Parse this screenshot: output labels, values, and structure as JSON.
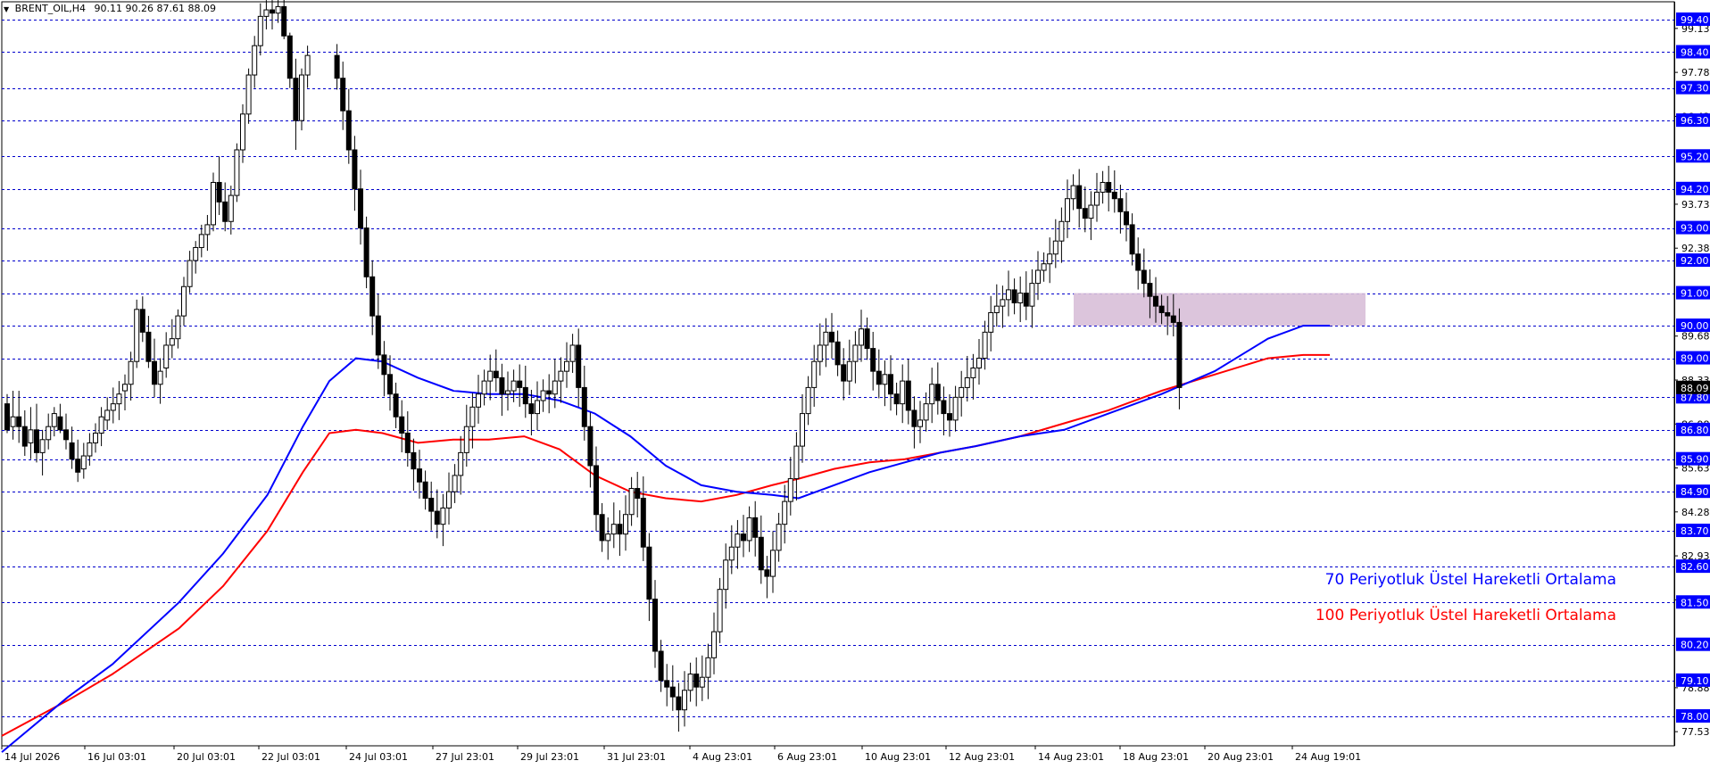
{
  "header": {
    "symbol": "BRENT_OIL,H4",
    "ohlc": "90.11 90.26 87.61 88.09"
  },
  "legend": {
    "ema70": "70 Periyotluk Üstel Hareketli Ortalama",
    "ema100": "100 Periyotluk Üstel Hareketli Ortalama"
  },
  "colors": {
    "background": "#ffffff",
    "grid": "#0000cc",
    "candle": "#000000",
    "ema70": "#0000ff",
    "ema100": "#ff0000",
    "zone": "#d8bfd8",
    "price_tag_bg": "#0000ff"
  },
  "chart_data": {
    "type": "candlestick",
    "ylim": [
      76.9,
      100.1
    ],
    "grid": true,
    "y_axis_ticks": [
      "99.40",
      "99.13",
      "98.40",
      "97.78",
      "97.30",
      "96.43",
      "96.30",
      "95.20",
      "94.20",
      "93.73",
      "93.00",
      "92.38",
      "92.00",
      "91.00",
      "90.00",
      "89.68",
      "89.00",
      "88.33",
      "87.80",
      "86.98",
      "86.80",
      "85.90",
      "85.63",
      "84.90",
      "84.28",
      "83.70",
      "82.93",
      "82.60",
      "81.50",
      "81.58",
      "80.20",
      "79.10",
      "78.88",
      "78.00",
      "77.53"
    ],
    "y_axis_ticks_clean": [
      "99.13",
      "97.78",
      "96.43",
      "93.73",
      "92.38",
      "89.68",
      "88.33",
      "86.98",
      "85.63",
      "84.28",
      "82.93",
      "81.58",
      "78.88",
      "77.53"
    ],
    "horizontal_levels": [
      "99.40",
      "98.40",
      "97.30",
      "96.30",
      "95.20",
      "94.20",
      "93.00",
      "92.00",
      "91.00",
      "90.00",
      "89.00",
      "87.80",
      "86.80",
      "85.90",
      "84.90",
      "83.70",
      "82.60",
      "81.50",
      "80.20",
      "79.10",
      "78.00"
    ],
    "current_price": "88.09",
    "x_axis_labels": [
      "14 Jul 2026",
      "16 Jul 03:01",
      "20 Jul 03:01",
      "22 Jul 03:01",
      "24 Jul 03:01",
      "27 Jul 23:01",
      "29 Jul 23:01",
      "31 Jul 23:01",
      "4 Aug 23:01",
      "6 Aug 23:01",
      "10 Aug 23:01",
      "12 Aug 23:01",
      "14 Aug 23:01",
      "18 Aug 23:01",
      "20 Aug 23:01",
      "24 Aug 19:01"
    ],
    "zone": {
      "from": 90.0,
      "to": 91.0
    },
    "ema70": [
      [
        0,
        76.9
      ],
      [
        15,
        78.6
      ],
      [
        25,
        79.6
      ],
      [
        40,
        81.5
      ],
      [
        50,
        83.0
      ],
      [
        60,
        84.8
      ],
      [
        68,
        86.9
      ],
      [
        74,
        88.3
      ],
      [
        80,
        89.0
      ],
      [
        86,
        88.9
      ],
      [
        94,
        88.4
      ],
      [
        102,
        88.0
      ],
      [
        110,
        87.9
      ],
      [
        118,
        87.9
      ],
      [
        126,
        87.7
      ],
      [
        134,
        87.3
      ],
      [
        142,
        86.6
      ],
      [
        150,
        85.7
      ],
      [
        158,
        85.1
      ],
      [
        166,
        84.9
      ],
      [
        174,
        84.8
      ],
      [
        180,
        84.7
      ],
      [
        188,
        85.1
      ],
      [
        196,
        85.5
      ],
      [
        204,
        85.8
      ],
      [
        212,
        86.1
      ],
      [
        220,
        86.3
      ],
      [
        230,
        86.6
      ],
      [
        240,
        86.8
      ],
      [
        250,
        87.3
      ],
      [
        262,
        87.9
      ],
      [
        274,
        88.6
      ],
      [
        286,
        89.6
      ],
      [
        294,
        90.0
      ],
      [
        300,
        90.0
      ]
    ],
    "ema100": [
      [
        0,
        77.4
      ],
      [
        15,
        78.5
      ],
      [
        25,
        79.3
      ],
      [
        40,
        80.7
      ],
      [
        50,
        82.0
      ],
      [
        60,
        83.7
      ],
      [
        68,
        85.5
      ],
      [
        74,
        86.7
      ],
      [
        80,
        86.8
      ],
      [
        86,
        86.7
      ],
      [
        94,
        86.4
      ],
      [
        102,
        86.5
      ],
      [
        110,
        86.5
      ],
      [
        118,
        86.6
      ],
      [
        126,
        86.2
      ],
      [
        134,
        85.4
      ],
      [
        142,
        84.9
      ],
      [
        150,
        84.7
      ],
      [
        158,
        84.6
      ],
      [
        166,
        84.8
      ],
      [
        174,
        85.1
      ],
      [
        180,
        85.3
      ],
      [
        188,
        85.6
      ],
      [
        196,
        85.8
      ],
      [
        204,
        85.9
      ],
      [
        212,
        86.1
      ],
      [
        220,
        86.3
      ],
      [
        230,
        86.6
      ],
      [
        240,
        87.0
      ],
      [
        250,
        87.4
      ],
      [
        262,
        88.0
      ],
      [
        274,
        88.5
      ],
      [
        286,
        89.0
      ],
      [
        294,
        89.1
      ],
      [
        300,
        89.1
      ]
    ],
    "ohlc": [
      [
        87.6,
        87.9,
        86.7,
        86.8
      ],
      [
        86.9,
        88.0,
        86.5,
        87.2
      ],
      [
        87.2,
        88.0,
        86.4,
        86.9
      ],
      [
        86.9,
        87.4,
        86.0,
        86.3
      ],
      [
        86.4,
        87.5,
        85.9,
        86.8
      ],
      [
        86.8,
        87.6,
        85.8,
        86.1
      ],
      [
        86.1,
        86.8,
        85.4,
        86.5
      ],
      [
        86.5,
        87.3,
        86.2,
        86.9
      ],
      [
        86.9,
        87.5,
        86.6,
        87.3
      ],
      [
        87.2,
        87.6,
        86.7,
        86.8
      ],
      [
        86.8,
        87.3,
        86.2,
        86.5
      ],
      [
        86.4,
        86.9,
        85.6,
        85.9
      ],
      [
        85.9,
        86.5,
        85.2,
        85.5
      ],
      [
        85.6,
        86.4,
        85.3,
        86.0
      ],
      [
        86.0,
        86.7,
        85.7,
        86.4
      ],
      [
        86.4,
        87.0,
        86.1,
        86.7
      ],
      [
        86.7,
        87.5,
        86.3,
        87.2
      ],
      [
        87.1,
        87.8,
        86.8,
        87.4
      ],
      [
        87.4,
        88.1,
        87.0,
        87.6
      ],
      [
        87.6,
        88.3,
        87.1,
        87.9
      ],
      [
        88.0,
        88.5,
        87.4,
        88.2
      ],
      [
        88.2,
        89.2,
        87.7,
        88.9
      ],
      [
        88.9,
        90.8,
        88.7,
        90.5
      ],
      [
        90.5,
        90.9,
        89.5,
        89.8
      ],
      [
        89.8,
        90.3,
        88.7,
        88.9
      ],
      [
        88.9,
        89.6,
        87.8,
        88.2
      ],
      [
        88.2,
        89.0,
        87.6,
        88.6
      ],
      [
        88.7,
        89.8,
        88.4,
        89.4
      ],
      [
        89.4,
        90.2,
        89.0,
        89.6
      ],
      [
        89.6,
        90.5,
        89.3,
        90.3
      ],
      [
        90.3,
        91.5,
        90.0,
        91.2
      ],
      [
        91.2,
        92.3,
        91.0,
        92.0
      ],
      [
        92.0,
        92.6,
        91.6,
        92.4
      ],
      [
        92.4,
        93.1,
        92.1,
        92.8
      ],
      [
        92.8,
        93.4,
        92.3,
        93.1
      ],
      [
        93.1,
        94.7,
        92.9,
        94.4
      ],
      [
        94.4,
        95.2,
        93.4,
        93.8
      ],
      [
        93.8,
        94.4,
        92.9,
        93.2
      ],
      [
        93.2,
        94.3,
        92.8,
        94.0
      ],
      [
        94.0,
        95.6,
        93.8,
        95.4
      ],
      [
        95.4,
        96.8,
        95.0,
        96.5
      ],
      [
        96.5,
        97.9,
        96.2,
        97.7
      ],
      [
        97.7,
        98.9,
        97.3,
        98.6
      ],
      [
        98.6,
        99.9,
        98.3,
        99.5
      ],
      [
        99.5,
        100.0,
        99.1,
        99.7
      ],
      [
        99.7,
        100.0,
        99.1,
        99.6
      ],
      [
        99.6,
        100.0,
        99.3,
        99.8
      ],
      [
        99.8,
        100.1,
        98.8,
        98.9
      ],
      [
        98.9,
        99.0,
        97.3,
        97.6
      ],
      [
        97.6,
        98.2,
        95.4,
        96.3
      ],
      [
        96.3,
        97.9,
        96.0,
        97.7
      ],
      [
        97.7,
        98.6,
        97.3,
        98.3
      ]
    ],
    "series": [
      {
        "name": "70 Periyotluk Üstel Hareketli Ortalama"
      },
      {
        "name": "100 Periyotluk Üstel Hareketli Ortalama"
      }
    ]
  }
}
